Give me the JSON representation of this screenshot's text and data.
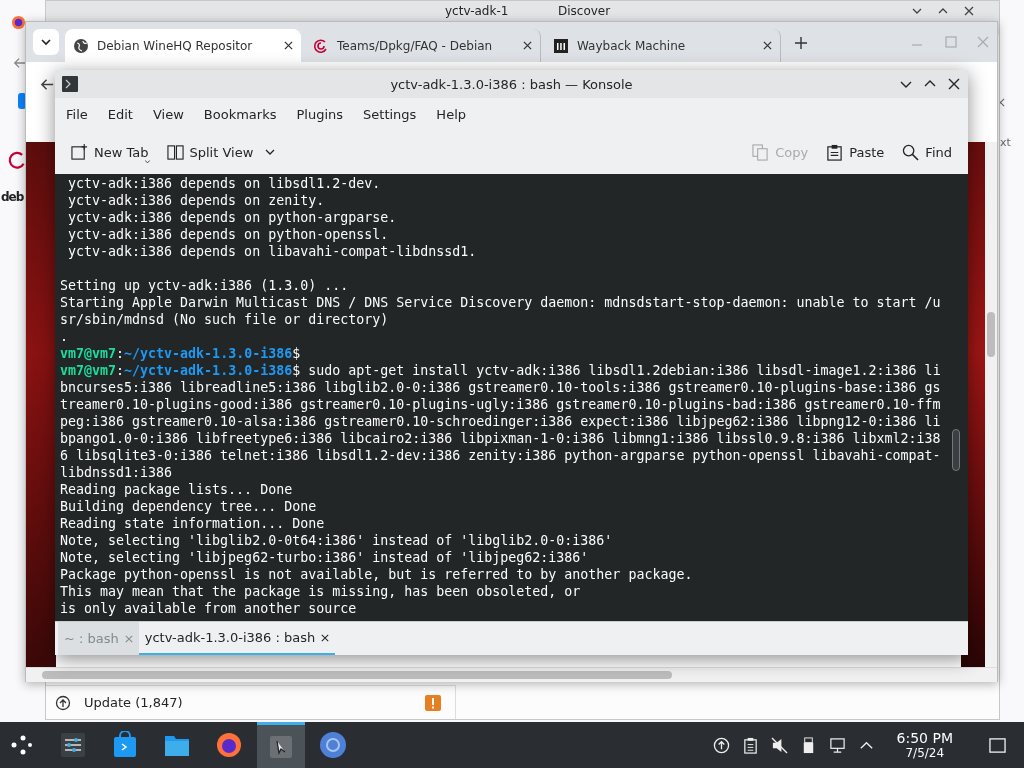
{
  "back_window": {
    "logo_text": "deb",
    "side_text": "xt"
  },
  "discover": {
    "title_start": "yctv-adk-1",
    "title_end": "Discover",
    "update_label": "Update (1,847)"
  },
  "browser": {
    "tabs": [
      {
        "title": "Debian WineHQ Repositor",
        "selected": true
      },
      {
        "title": "Teams/Dpkg/FAQ - Debian",
        "selected": false
      },
      {
        "title": "Wayback Machine",
        "selected": false
      }
    ]
  },
  "konsole": {
    "title": "yctv-adk-1.3.0-i386 : bash — Konsole",
    "menu": [
      "File",
      "Edit",
      "View",
      "Bookmarks",
      "Plugins",
      "Settings",
      "Help"
    ],
    "toolbar": [
      {
        "label": "New Tab",
        "disabled": false
      },
      {
        "label": "Split View",
        "disabled": false
      },
      {
        "label": "Copy",
        "disabled": true
      },
      {
        "label": "Paste",
        "disabled": false
      },
      {
        "label": "Find",
        "disabled": false
      }
    ],
    "lines": [
      {
        "kind": "text",
        "text": " yctv-adk:i386 depends on libsdl1.2-dev."
      },
      {
        "kind": "text",
        "text": " yctv-adk:i386 depends on zenity."
      },
      {
        "kind": "text",
        "text": " yctv-adk:i386 depends on python-argparse."
      },
      {
        "kind": "text",
        "text": " yctv-adk:i386 depends on python-openssl."
      },
      {
        "kind": "text",
        "text": " yctv-adk:i386 depends on libavahi-compat-libdnssd1."
      },
      {
        "kind": "blank"
      },
      {
        "kind": "text",
        "text": "Setting up yctv-adk:i386 (1.3.0) ..."
      },
      {
        "kind": "text",
        "text": "Starting Apple Darwin Multicast DNS / DNS Service Discovery daemon: mdnsdstart-stop-daemon: unable to start /u"
      },
      {
        "kind": "text",
        "text": "sr/sbin/mdnsd (No such file or directory)"
      },
      {
        "kind": "text",
        "text": "."
      },
      {
        "kind": "prompt",
        "user": "vm7@vm7",
        "separator": ":",
        "path": "~/yctv-adk-1.3.0-i386",
        "symbol": "$"
      },
      {
        "kind": "prompt",
        "user": "vm7@vm7",
        "separator": ":",
        "path": "~/yctv-adk-1.3.0-i386",
        "symbol": "$",
        "command": " sudo apt-get install yctv-adk:i386 libsdl1.2debian:i386 libsdl-image1.2:i386 li"
      },
      {
        "kind": "text",
        "text": "bncurses5:i386 libreadline5:i386 libglib2.0-0:i386 gstreamer0.10-tools:i386 gstreamer0.10-plugins-base:i386 gs"
      },
      {
        "kind": "text",
        "text": "treamer0.10-plugins-good:i386 gstreamer0.10-plugins-ugly:i386 gstreamer0.10-plugins-bad:i386 gstreamer0.10-ffm"
      },
      {
        "kind": "text",
        "text": "peg:i386 gstreamer0.10-alsa:i386 gstreamer0.10-schroedinger:i386 expect:i386 libjpeg62:i386 libpng12-0:i386 li"
      },
      {
        "kind": "text",
        "text": "bpango1.0-0:i386 libfreetype6:i386 libcairo2:i386 libpixman-1-0:i386 libmng1:i386 libssl0.9.8:i386 libxml2:i38"
      },
      {
        "kind": "text",
        "text": "6 libsqlite3-0:i386 telnet:i386 libsdl1.2-dev:i386 zenity:i386 python-argparse python-openssl libavahi-compat-"
      },
      {
        "kind": "text",
        "text": "libdnssd1:i386"
      },
      {
        "kind": "text",
        "text": "Reading package lists... Done"
      },
      {
        "kind": "text",
        "text": "Building dependency tree... Done"
      },
      {
        "kind": "text",
        "text": "Reading state information... Done"
      },
      {
        "kind": "text",
        "text": "Note, selecting 'libglib2.0-0t64:i386' instead of 'libglib2.0-0:i386'"
      },
      {
        "kind": "text",
        "text": "Note, selecting 'libjpeg62-turbo:i386' instead of 'libjpeg62:i386'"
      },
      {
        "kind": "text",
        "text": "Package python-openssl is not available, but is referred to by another package."
      },
      {
        "kind": "text",
        "text": "This may mean that the package is missing, has been obsoleted, or"
      },
      {
        "kind": "text",
        "text": "is only available from another source"
      }
    ],
    "tabs": [
      {
        "label": "~ : bash",
        "selected": false
      },
      {
        "label": "yctv-adk-1.3.0-i386 : bash",
        "selected": true
      }
    ]
  },
  "taskbar": {
    "apps": [
      {
        "active": false
      },
      {
        "active": false
      },
      {
        "active": false
      },
      {
        "active": false
      },
      {
        "active": true
      },
      {
        "active": false
      }
    ],
    "time": "6:50 PM",
    "date": "7/5/24"
  }
}
